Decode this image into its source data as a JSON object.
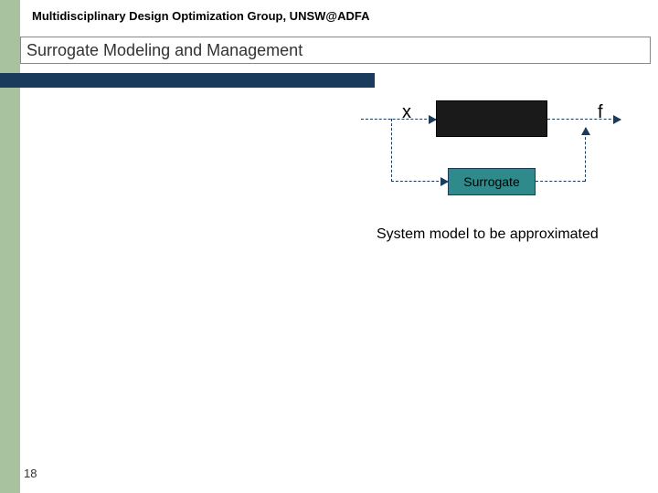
{
  "header": {
    "organization": "Multidisciplinary Design Optimization Group, UNSW@ADFA"
  },
  "title": "Surrogate Modeling and Management",
  "diagram": {
    "input_label": "x",
    "output_label": "f",
    "surrogate_label": "Surrogate",
    "caption": "System model to be approximated"
  },
  "page_number": "18",
  "colors": {
    "left_stripe": "#a8c2a0",
    "accent_bar": "#1a3b5c",
    "surrogate_fill": "#2f8b8b"
  }
}
